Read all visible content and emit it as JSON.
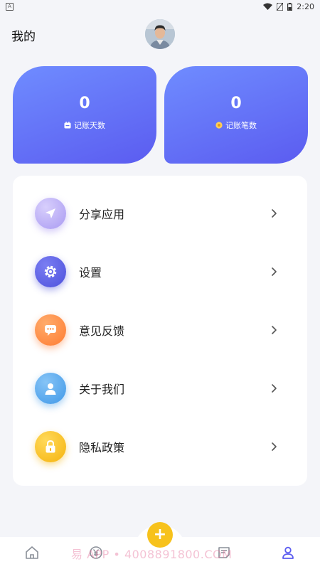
{
  "status_bar": {
    "app_icon_letter": "A",
    "time": "2:20"
  },
  "header": {
    "title": "我的"
  },
  "stats": {
    "days_value": "0",
    "days_label": "记账天数",
    "entries_value": "0",
    "entries_label": "记账笔数"
  },
  "menu": {
    "items": [
      {
        "label": "分享应用",
        "icon": "share-icon",
        "color": "#b3a6f5"
      },
      {
        "label": "设置",
        "icon": "gear-icon",
        "color": "#5a5ee8"
      },
      {
        "label": "意见反馈",
        "icon": "message-icon",
        "color": "#ff8a3d"
      },
      {
        "label": "关于我们",
        "icon": "user-icon",
        "color": "#4fa5ee"
      },
      {
        "label": "隐私政策",
        "icon": "lock-icon",
        "color": "#f7bd1c"
      }
    ]
  },
  "tabbar": {
    "fab_label": "+",
    "watermark": "易    APP • 4008891800.COM",
    "tabs": [
      {
        "name": "home",
        "icon": "home-icon"
      },
      {
        "name": "ledger",
        "icon": "yen-icon"
      },
      {
        "name": "notes",
        "icon": "note-icon"
      },
      {
        "name": "profile",
        "icon": "person-icon"
      }
    ]
  },
  "colors": {
    "accent": "#5b5cf0",
    "fab": "#f7c21c",
    "background": "#f4f5f9"
  }
}
